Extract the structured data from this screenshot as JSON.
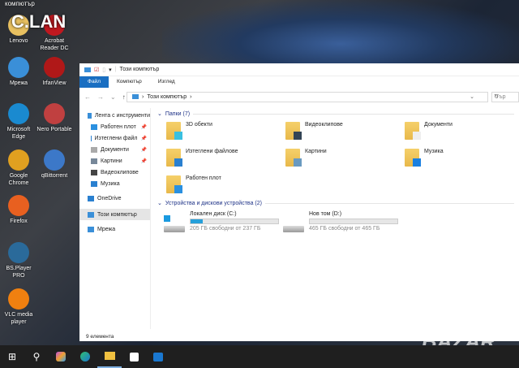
{
  "desktop": {
    "top_label": "компютър",
    "overlay_text": "C.LAN",
    "icons": [
      {
        "label": "Lenovo",
        "color": "#e8c060"
      },
      {
        "label": "Acrobat Reader DC",
        "color": "#c0181f"
      },
      {
        "label": "Мрежа",
        "color": "#3a8fd8"
      },
      {
        "label": "IrfanView",
        "color": "#b01818"
      },
      {
        "label": "Microsoft Edge",
        "color": "#1a8ad0"
      },
      {
        "label": "Nero Portable",
        "color": "#c04040"
      },
      {
        "label": "Google Chrome",
        "color": "#e0a020"
      },
      {
        "label": "qBittorrent",
        "color": "#3c78c8"
      },
      {
        "label": "Firefox",
        "color": "#e86020"
      },
      {
        "label": "BS.Player PRO",
        "color": "#2a6a9a"
      },
      {
        "label": "VLC media player",
        "color": "#f08010"
      }
    ]
  },
  "window": {
    "title": "Този компютър",
    "tabs": [
      "Файл",
      "Компютър",
      "Изглед"
    ],
    "address": "Този компютър",
    "search_placeholder": "Тър",
    "nav": [
      {
        "label": "Лента с инструменти",
        "pin": false
      },
      {
        "label": "Работен плот",
        "pin": true
      },
      {
        "label": "Изтеглени файл",
        "pin": true
      },
      {
        "label": "Документи",
        "pin": true
      },
      {
        "label": "Картини",
        "pin": true
      },
      {
        "label": "Видеоклипове",
        "pin": false
      },
      {
        "label": "Музика",
        "pin": false
      },
      {
        "label": "OneDrive",
        "pin": false
      },
      {
        "label": "Този компютър",
        "pin": false,
        "selected": true
      },
      {
        "label": "Мрежа",
        "pin": false
      }
    ],
    "folders_header": "Папки (7)",
    "folders": [
      "3D обекти",
      "Видеоклипове",
      "Документи",
      "Изтеглени файлове",
      "Картини",
      "Музика",
      "Работен плот"
    ],
    "drives_header": "Устройства и дискови устройства (2)",
    "drives": [
      {
        "name": "Локален диск (C:)",
        "info": "205 ГБ свободни от 237 ГБ",
        "used_percent": 13.5
      },
      {
        "name": "Нов том (D:)",
        "info": "465 ГБ свободни от 465 ГБ",
        "used_percent": 0
      }
    ],
    "status": "9 елемента"
  },
  "watermark": "BAZAR",
  "accent": "#1a6fc2"
}
